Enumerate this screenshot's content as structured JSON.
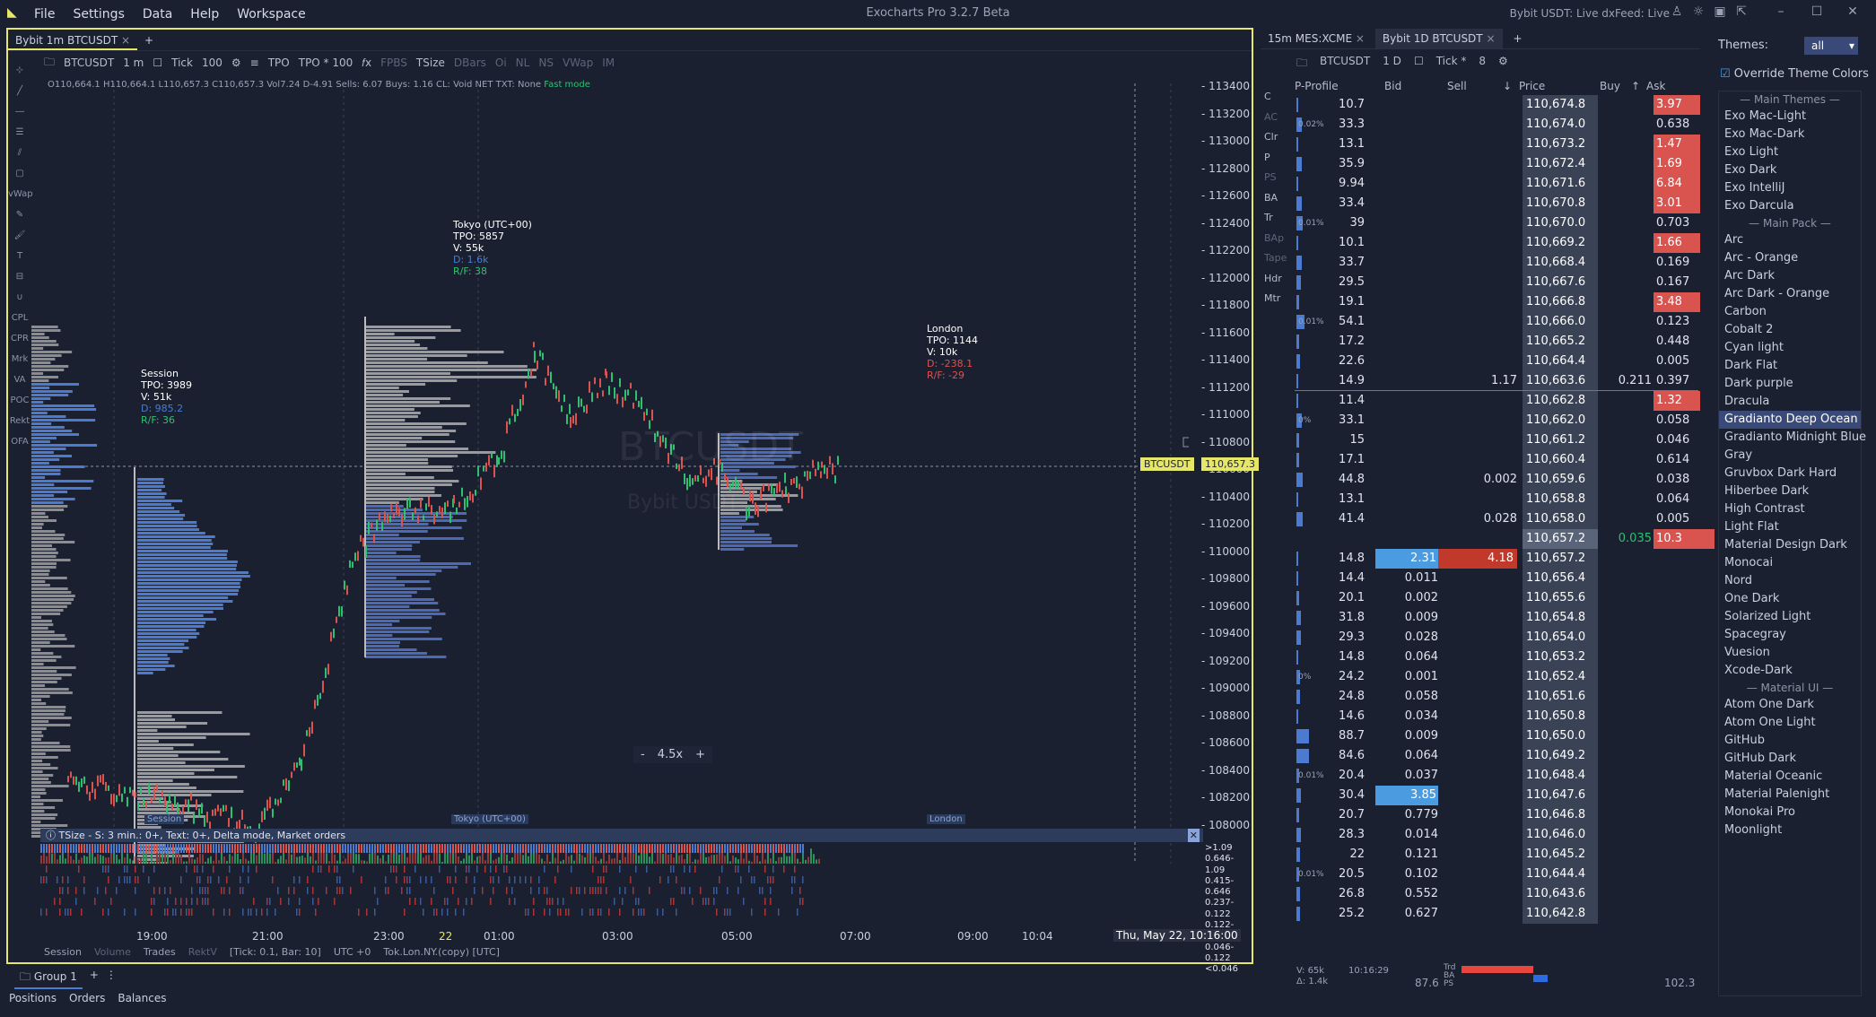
{
  "app": {
    "title": "Exocharts Pro 3.2.7 Beta",
    "menu": [
      "File",
      "Settings",
      "Data",
      "Help",
      "Workspace"
    ],
    "feed_status": "Bybit USDT: Live  dxFeed: Live"
  },
  "chart": {
    "tab": "Bybit 1m BTCUSDT",
    "toolbar": {
      "symbol": "BTCUSDT",
      "timeframe": "1 m",
      "tick": "Tick",
      "tick_value": "100",
      "tpo": "TPO",
      "tpo2": "TPO * 100",
      "items": [
        "FPBS",
        "TSize",
        "DBars",
        "Oi",
        "NL",
        "NS",
        "VWap",
        "IM"
      ]
    },
    "stats": "O110,664.1 H110,664.1 L110,657.3 C110,657.3  Vol7.24 D-4.91  Sells: 6.07 Buys: 1.16   CL: Void NET TXT: None",
    "fast_mode": "Fast mode",
    "left_tools": [
      "vWap",
      "CPL",
      "CPR",
      "Mrk",
      "VA",
      "POC",
      "Rekt",
      "OFA"
    ],
    "y_labels": [
      "113400",
      "113200",
      "113000",
      "112800",
      "112600",
      "112400",
      "112200",
      "112000",
      "111800",
      "111600",
      "111400",
      "111200",
      "111000",
      "110800",
      "110600",
      "110400",
      "110200",
      "110000",
      "109800",
      "109600",
      "109400",
      "109200",
      "109000",
      "108800",
      "108600",
      "108400",
      "108200",
      "108000"
    ],
    "x_labels": [
      "19:00",
      "21:00",
      "23:00",
      "22",
      "01:00",
      "03:00",
      "05:00",
      "07:00",
      "09:00",
      "10:04"
    ],
    "date_label": "Thu, May 22, 10:16:00",
    "price_tag": "110,657.3",
    "symbol_tag": "BTCUSDT",
    "watermark": "BTCUSDT",
    "watermark2": "Bybit USDT",
    "zoom": "4.5x",
    "sessions": [
      {
        "name": "Session",
        "tpo": "TPO: 3989",
        "v": "V: 51k",
        "d": "D: 985.2",
        "rf": "R/F: 36"
      },
      {
        "name": "Tokyo (UTC+00)",
        "tpo": "TPO: 5857",
        "v": "V: 55k",
        "d": "D: 1.6k",
        "rf": "R/F: 38"
      },
      {
        "name": "London",
        "tpo": "TPO: 1144",
        "v": "V: 10k",
        "d": "D: -238.1",
        "rf": "R/F: -29"
      }
    ],
    "session_tags": [
      "Session",
      "Tokyo (UTC+00)",
      "London"
    ],
    "tsize_bar": "TSize - S: 3 min.: 0+, Text: 0+, Delta mode,  Market orders",
    "tsize_legend": [
      ">1.09",
      "0.646-1.09",
      "0.415-0.646",
      "0.237-0.122",
      "0.122-0.237",
      "0.046-0.122",
      "<0.046"
    ],
    "status": [
      "Session",
      "Volume",
      "Trades",
      "RektV",
      "[Tick: 0.1, Bar: 10]",
      "UTC +0",
      "Tok.Lon.NY.(copy) [UTC]"
    ]
  },
  "dom": {
    "tabs": [
      "15m MES:XCME",
      "Bybit 1D BTCUSDT"
    ],
    "symbol": "BTCUSDT",
    "tf": "1 D",
    "tick": "Tick *",
    "tick_value": "8",
    "side_labels": [
      "C",
      "AC",
      "Clr",
      "P",
      "PS",
      "BA",
      "Tr",
      "BAp",
      "Tape",
      "Hdr",
      "Mtr"
    ],
    "headers": [
      "P-Profile",
      "Bid",
      "Sell",
      "Price",
      "Buy",
      "Ask"
    ],
    "rows": [
      {
        "pp": "10.7",
        "price": "110,674.8",
        "ask": "3.97",
        "askhl": true
      },
      {
        "pp": "33.3",
        "price": "110,674.0",
        "ask": "0.638",
        "pct": "0.02%"
      },
      {
        "pp": "13.1",
        "price": "110,673.2",
        "ask": "1.47",
        "askhl": true
      },
      {
        "pp": "35.9",
        "price": "110,672.4",
        "ask": "1.69",
        "askhl": true
      },
      {
        "pp": "9.94",
        "price": "110,671.6",
        "ask": "6.84",
        "askhl": true
      },
      {
        "pp": "33.4",
        "price": "110,670.8",
        "ask": "3.01",
        "askhl": true
      },
      {
        "pp": "39",
        "price": "110,670.0",
        "ask": "0.703",
        "pct": "0.01%"
      },
      {
        "pp": "10.1",
        "price": "110,669.2",
        "ask": "1.66",
        "askhl": true
      },
      {
        "pp": "33.7",
        "price": "110,668.4",
        "ask": "0.169"
      },
      {
        "pp": "29.5",
        "price": "110,667.6",
        "ask": "0.167"
      },
      {
        "pp": "19.1",
        "price": "110,666.8",
        "ask": "3.48",
        "askhl": true
      },
      {
        "pp": "54.1",
        "price": "110,666.0",
        "ask": "0.123",
        "pct": "0.01%"
      },
      {
        "pp": "17.2",
        "price": "110,665.2",
        "ask": "0.448"
      },
      {
        "pp": "22.6",
        "price": "110,664.4",
        "ask": "0.005"
      },
      {
        "pp": "14.9",
        "sell": "1.17",
        "price": "110,663.6",
        "buy": "0.211",
        "ask": "0.397"
      },
      {
        "pp": "11.4",
        "price": "110,662.8",
        "ask": "1.32",
        "askhl": true
      },
      {
        "pp": "33.1",
        "price": "110,662.0",
        "ask": "0.058",
        "pct": "0%"
      },
      {
        "pp": "15",
        "price": "110,661.2",
        "ask": "0.046"
      },
      {
        "pp": "17.1",
        "price": "110,660.4",
        "ask": "0.614"
      },
      {
        "pp": "44.8",
        "sell": "0.002",
        "price": "110,659.6",
        "ask": "0.038"
      },
      {
        "pp": "13.1",
        "price": "110,658.8",
        "ask": "0.064"
      },
      {
        "pp": "41.4",
        "sell": "0.028",
        "price": "110,658.0",
        "ask": "0.005"
      },
      {
        "pp": "",
        "price": "110,657.2",
        "buy": "0.035",
        "ask": "10.3",
        "askhl": true,
        "last": true
      },
      {
        "pp": "14.8",
        "bid": "2.31",
        "sell": "4.18",
        "price": "110,657.2",
        "bidhl": true,
        "sellhl": true
      },
      {
        "pp": "14.4",
        "bid": "0.011",
        "price": "110,656.4"
      },
      {
        "pp": "20.1",
        "bid": "0.002",
        "price": "110,655.6"
      },
      {
        "pp": "31.8",
        "bid": "0.009",
        "price": "110,654.8"
      },
      {
        "pp": "29.3",
        "bid": "0.028",
        "price": "110,654.0"
      },
      {
        "pp": "14.8",
        "bid": "0.064",
        "price": "110,653.2"
      },
      {
        "pp": "24.2",
        "bid": "0.001",
        "price": "110,652.4",
        "pct": "0%"
      },
      {
        "pp": "24.8",
        "bid": "0.058",
        "price": "110,651.6"
      },
      {
        "pp": "14.6",
        "bid": "0.034",
        "price": "110,650.8"
      },
      {
        "pp": "88.7",
        "bid": "0.009",
        "price": "110,650.0"
      },
      {
        "pp": "84.6",
        "bid": "0.064",
        "price": "110,649.2"
      },
      {
        "pp": "20.4",
        "bid": "0.037",
        "price": "110,648.4",
        "pct": "0.01%"
      },
      {
        "pp": "30.4",
        "bid": "3.85",
        "price": "110,647.6",
        "bidhl": true
      },
      {
        "pp": "20.7",
        "bid": "0.779",
        "price": "110,646.8"
      },
      {
        "pp": "28.3",
        "bid": "0.014",
        "price": "110,646.0"
      },
      {
        "pp": "22",
        "bid": "0.121",
        "price": "110,645.2"
      },
      {
        "pp": "20.5",
        "bid": "0.102",
        "price": "110,644.4",
        "pct": "0.01%"
      },
      {
        "pp": "26.8",
        "bid": "0.552",
        "price": "110,643.6"
      },
      {
        "pp": "25.2",
        "bid": "0.627",
        "price": "110,642.8"
      }
    ],
    "footer": {
      "v": "V: 65k",
      "d": "Δ: 1.4k",
      "time": "10:16:29",
      "left": "87.6",
      "right": "102.3",
      "labels": [
        "Trd",
        "BA",
        "PS"
      ]
    }
  },
  "themes": {
    "label": "Themes:",
    "filter": "all",
    "override": "Override Theme Colors",
    "groups": [
      {
        "head": "Main Themes",
        "items": [
          "Exo Mac-Light",
          "Exo Mac-Dark",
          "Exo Light",
          "Exo Dark",
          "Exo IntelliJ",
          "Exo Darcula"
        ]
      },
      {
        "head": "Main Pack",
        "items": [
          "Arc",
          "Arc - Orange",
          "Arc Dark",
          "Arc Dark - Orange",
          "Carbon",
          "Cobalt 2",
          "Cyan light",
          "Dark Flat",
          "Dark purple",
          "Dracula",
          "Gradianto Deep Ocean",
          "Gradianto Midnight Blue",
          "Gray",
          "Gruvbox Dark Hard",
          "Hiberbee Dark",
          "High Contrast",
          "Light Flat",
          "Material Design Dark",
          "Monocai",
          "Nord",
          "One Dark",
          "Solarized Light",
          "Spacegray",
          "Vuesion",
          "Xcode-Dark"
        ]
      },
      {
        "head": "Material UI",
        "items": [
          "Atom One Dark",
          "Atom One Light",
          "GitHub",
          "GitHub Dark",
          "Material Oceanic",
          "Material Palenight",
          "Monokai Pro",
          "Moonlight"
        ]
      }
    ],
    "selected": "Gradianto Deep Ocean"
  },
  "bottom": {
    "group": "Group 1",
    "tabs": [
      "Positions",
      "Orders",
      "Balances"
    ]
  },
  "colors": {
    "bg": "#1b2030",
    "accent": "#e5e66a",
    "bid": "#4a7bd0",
    "ask": "#d9534f",
    "buy": "#2fbf71"
  }
}
